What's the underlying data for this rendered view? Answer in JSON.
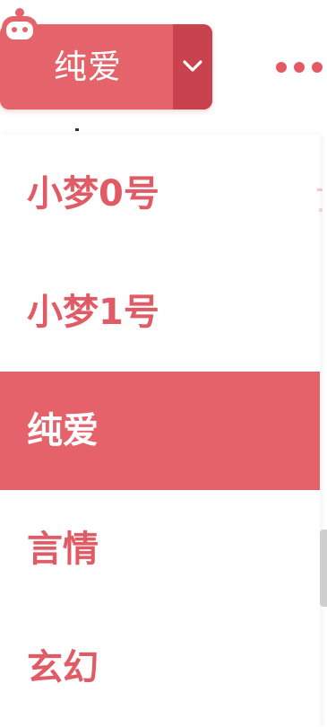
{
  "dropdown": {
    "selected_label": "纯爱",
    "accent_color": "#e5636b",
    "chevron_color": "#c9434f",
    "chevron_icon": "chevron-down-icon",
    "mascot_icon": "mascot-robot-icon"
  },
  "header": {
    "more_icon": "more-horizontal-icon"
  },
  "menu": {
    "items": [
      {
        "label": "小梦0号",
        "selected": false
      },
      {
        "label": "小梦1号",
        "selected": false
      },
      {
        "label": "纯爱",
        "selected": true
      },
      {
        "label": "言情",
        "selected": false
      },
      {
        "label": "玄幻",
        "selected": false
      }
    ]
  }
}
